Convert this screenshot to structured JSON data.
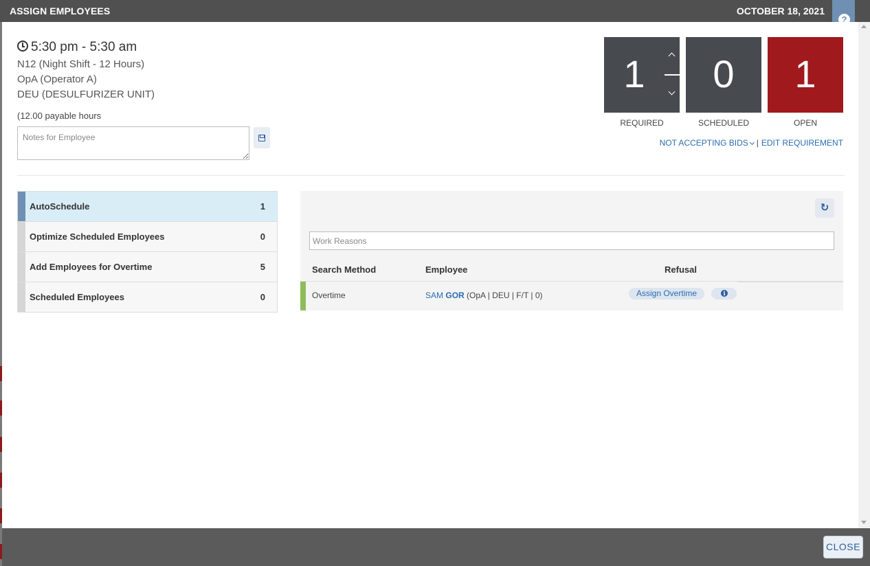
{
  "header": {
    "title": "ASSIGN EMPLOYEES",
    "date": "OCTOBER 18, 2021",
    "help_icon": "?"
  },
  "shift": {
    "time": "5:30 pm - 5:30 am",
    "shift_name": "N12 (Night Shift - 12 Hours)",
    "position": "OpA (Operator A)",
    "unit": "DEU (DESULFURIZER UNIT)",
    "payable": "(12.00 payable hours",
    "notes_placeholder": "Notes for Employee"
  },
  "counters": {
    "required": {
      "value": "1",
      "label": "REQUIRED"
    },
    "scheduled": {
      "value": "0",
      "label": "SCHEDULED"
    },
    "open": {
      "value": "1",
      "label": "OPEN"
    }
  },
  "links": {
    "bids": "NOT ACCEPTING BIDS",
    "separator": "|",
    "edit": "EDIT REQUIREMENT"
  },
  "menu": {
    "items": [
      {
        "label": "AutoSchedule",
        "count": "1",
        "active": true
      },
      {
        "label": "Optimize Scheduled Employees",
        "count": "0",
        "active": false
      },
      {
        "label": "Add Employees for Overtime",
        "count": "5",
        "active": false
      },
      {
        "label": "Scheduled Employees",
        "count": "0",
        "active": false
      }
    ]
  },
  "panel": {
    "work_reasons_placeholder": "Work Reasons",
    "columns": {
      "method": "Search Method",
      "employee": "Employee",
      "refusal": "Refusal"
    },
    "rows": [
      {
        "method": "Overtime",
        "first_name": "SAM",
        "last_name": "GOR",
        "details": "(OpA | DEU | F/T | 0)",
        "assign_label": "Assign Overtime",
        "info_glyph": "i"
      }
    ]
  },
  "footer": {
    "close_label": "CLOSE"
  },
  "colors": {
    "header": "#505050",
    "accent_blue": "#2a6db0",
    "open_red": "#a0191d",
    "counter_gray": "#474a4f",
    "row_green": "#8fbc5a"
  },
  "icons": [
    "clock-icon",
    "save-icon",
    "chevron-up-icon",
    "chevron-down-icon",
    "refresh-icon",
    "info-icon",
    "help-icon"
  ]
}
